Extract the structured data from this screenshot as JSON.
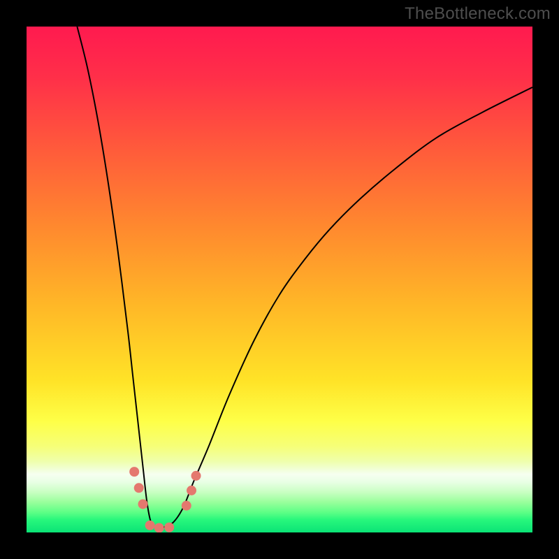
{
  "watermark": "TheBottleneck.com",
  "chart_data": {
    "type": "line",
    "title": "",
    "xlabel": "",
    "ylabel": "",
    "xlim": [
      0,
      100
    ],
    "ylim": [
      0,
      100
    ],
    "grid": false,
    "legend": false,
    "gradient_stops": [
      {
        "pos": 0.0,
        "color": "#ff1a4f"
      },
      {
        "pos": 0.1,
        "color": "#ff2f49"
      },
      {
        "pos": 0.25,
        "color": "#ff5d3a"
      },
      {
        "pos": 0.4,
        "color": "#ff8a2e"
      },
      {
        "pos": 0.55,
        "color": "#ffb727"
      },
      {
        "pos": 0.7,
        "color": "#ffe327"
      },
      {
        "pos": 0.78,
        "color": "#feff47"
      },
      {
        "pos": 0.83,
        "color": "#f6ff78"
      },
      {
        "pos": 0.86,
        "color": "#efffad"
      },
      {
        "pos": 0.875,
        "color": "#f1ffd6"
      },
      {
        "pos": 0.885,
        "color": "#f6fff0"
      },
      {
        "pos": 0.9,
        "color": "#e9ffe5"
      },
      {
        "pos": 0.92,
        "color": "#c9ffc3"
      },
      {
        "pos": 0.94,
        "color": "#99ff9c"
      },
      {
        "pos": 0.96,
        "color": "#5eff86"
      },
      {
        "pos": 0.975,
        "color": "#28f77c"
      },
      {
        "pos": 1.0,
        "color": "#0be376"
      }
    ],
    "series": [
      {
        "name": "bottleneck-curve",
        "stroke": "#000000",
        "stroke_width": 2.0,
        "x": [
          10,
          12,
          14,
          16,
          18,
          20,
          21,
          22,
          23,
          23.8,
          24.6,
          25.5,
          27,
          29,
          31,
          33,
          36,
          40,
          45,
          50,
          55,
          60,
          66,
          73,
          81,
          90,
          100
        ],
        "y": [
          100,
          92,
          82,
          70,
          56,
          40,
          31,
          22,
          13,
          6,
          2,
          1,
          1,
          2,
          5,
          10,
          17,
          27,
          38,
          47,
          54,
          60,
          66,
          72,
          78,
          83,
          88
        ]
      }
    ],
    "markers": {
      "color": "#e4786e",
      "radius": 7,
      "points": [
        {
          "x": 21.3,
          "y": 12.0
        },
        {
          "x": 22.2,
          "y": 8.8
        },
        {
          "x": 23.0,
          "y": 5.6
        },
        {
          "x": 24.4,
          "y": 1.4
        },
        {
          "x": 26.2,
          "y": 0.9
        },
        {
          "x": 28.2,
          "y": 1.0
        },
        {
          "x": 31.6,
          "y": 5.3
        },
        {
          "x": 32.6,
          "y": 8.3
        },
        {
          "x": 33.5,
          "y": 11.2
        }
      ]
    }
  }
}
